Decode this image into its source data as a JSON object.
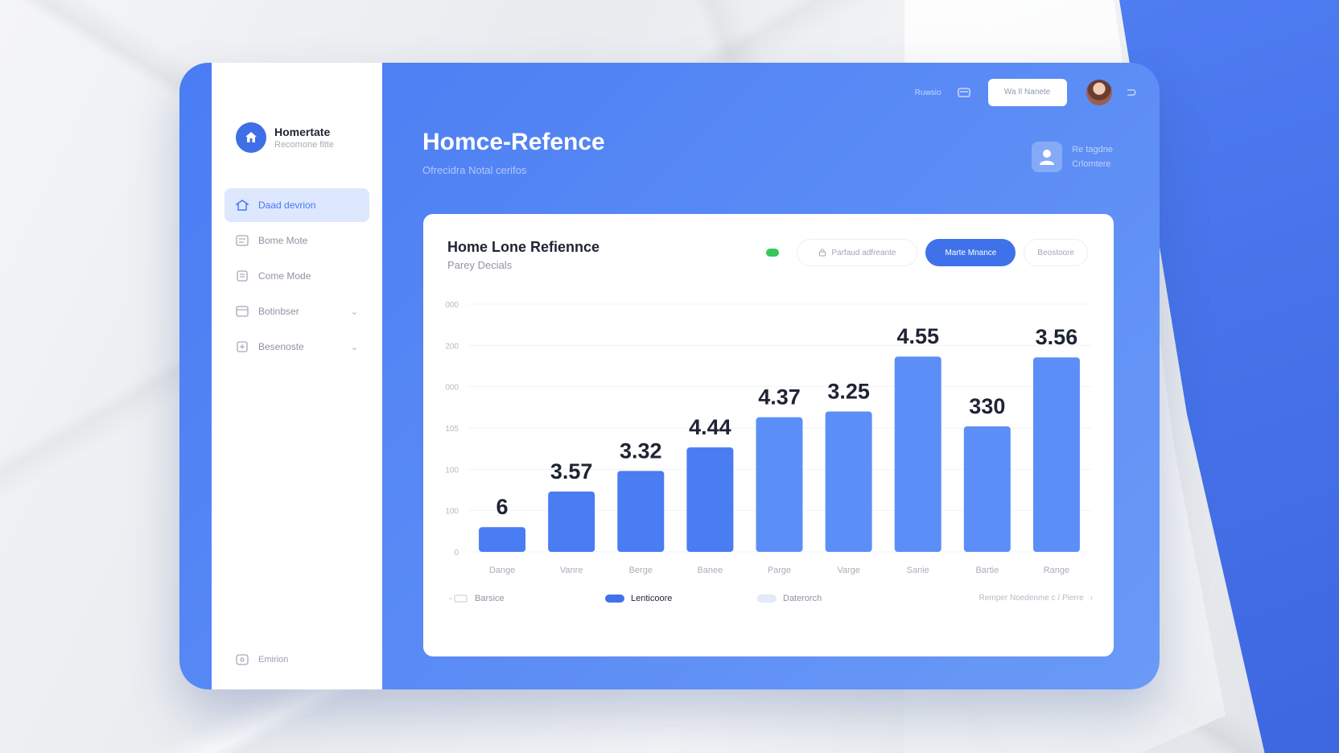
{
  "sidebar": {
    "brand_name": "Homertate",
    "brand_sub": "Recomone fitte",
    "items": [
      {
        "label": "Daad devrion",
        "icon": "home-icon",
        "active": true
      },
      {
        "label": "Bome Mote",
        "icon": "list-icon",
        "active": false
      },
      {
        "label": "Come Mode",
        "icon": "document-icon",
        "active": false
      },
      {
        "label": "Botinbser",
        "icon": "card-icon",
        "active": false
      },
      {
        "label": "Besenoste",
        "icon": "report-icon",
        "active": false
      }
    ],
    "footer_label": "Emirion"
  },
  "topbar": {
    "text": "Ruwsio",
    "button_label": "Wa Il Nanete",
    "menu_icon": "menu-icon",
    "avatar": "user-avatar",
    "logout_icon": "logout-icon"
  },
  "header": {
    "title": "Homce-Refence",
    "subtitle": "Ofrecidra Notal cerifos",
    "user_card_line1": "Re tagdne",
    "user_card_line2": "Crlomtere"
  },
  "card": {
    "title": "Home Lone Refiennce",
    "subtitle": "Parey Decials",
    "filter_pill": "Parfaud adfreante",
    "primary_pill": "Marte Mnance",
    "secondary_pill": "Beostoore"
  },
  "legend": {
    "item1": "Barsice",
    "item2": "Lenticoore",
    "item3": "Daterorch",
    "link": "Remper Noedenme c / Pierre"
  },
  "colors": {
    "accent": "#3f72ea",
    "bar": "#4a7cf2",
    "bar_light": "#5b8ff7",
    "legend_light": "#e3e9f6",
    "status": "#34c759"
  },
  "chart_data": {
    "type": "bar",
    "categories": [
      "Dange",
      "Vanre",
      "Berge",
      "Banee",
      "Parge",
      "Varge",
      "Sanie",
      "Bartie",
      "Range"
    ],
    "values": [
      0.6,
      1.46,
      1.96,
      2.53,
      3.26,
      3.4,
      4.73,
      3.04,
      4.71
    ],
    "data_labels": [
      "6",
      "3.57",
      "3.32",
      "4.44",
      "4.37",
      "3.25",
      "4.55",
      "330",
      "3.56"
    ],
    "y_tick_labels": [
      "0",
      "100",
      "100",
      "105",
      "000",
      "200",
      "000"
    ],
    "ylim": [
      0,
      6
    ],
    "grid": true
  }
}
